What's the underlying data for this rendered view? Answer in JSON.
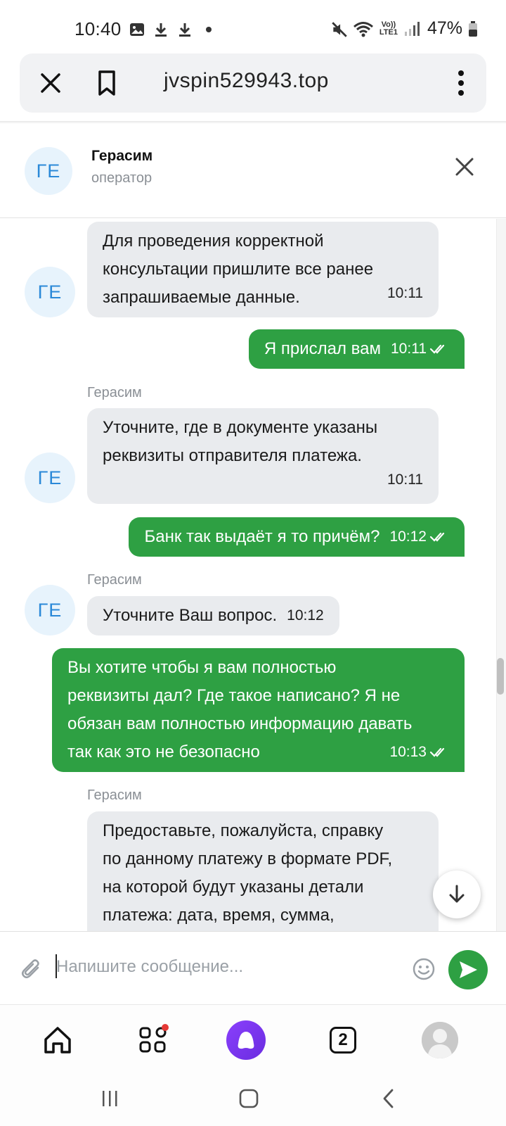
{
  "status_bar": {
    "time": "10:40",
    "battery": "47%",
    "network_label": "LTE1",
    "icons_left": [
      "gallery-icon",
      "download-icon",
      "download-icon",
      "dot-icon"
    ],
    "icons_right": [
      "mute-icon",
      "wifi-icon",
      "volte-icon",
      "signal-icon",
      "battery-icon"
    ]
  },
  "browser": {
    "url": "jvspin529943.top"
  },
  "chat_header": {
    "avatar_initials": "ГЕ",
    "name": "Герасим",
    "role": "оператор"
  },
  "messages": [
    {
      "direction": "in",
      "avatar": "ГЕ",
      "text_lines": [
        "Для проведения корректной",
        "консультации пришлите все ранее",
        "запрашиваемые данные."
      ],
      "time": "10:11"
    },
    {
      "direction": "out",
      "text": "Я прислал вам",
      "time": "10:11",
      "status": "read"
    },
    {
      "direction": "in",
      "sender": "Герасим",
      "avatar": "ГЕ",
      "text_lines": [
        "Уточните, где в документе указаны",
        "реквизиты отправителя платежа."
      ],
      "time": "10:11"
    },
    {
      "direction": "out",
      "text": "Банк так выдаёт я то причём?",
      "time": "10:12",
      "status": "read"
    },
    {
      "direction": "in",
      "sender": "Герасим",
      "avatar": "ГЕ",
      "text": "Уточните Ваш вопрос.",
      "time": "10:12"
    },
    {
      "direction": "out",
      "text_lines": [
        "Вы хотите чтобы я вам полностью",
        "реквизиты дал? Где такое написано? Я не",
        "обязан вам полностью информацию давать",
        "так как это не безопасно"
      ],
      "time": "10:13",
      "status": "read"
    },
    {
      "direction": "in",
      "sender": "Герасим",
      "text_lines": [
        "Предоставьте, пожалуйста, справку",
        "по данному платежу в формате PDF,",
        "на которой будут указаны детали",
        "платежа: дата, время, сумма,"
      ]
    }
  ],
  "input": {
    "placeholder": "Напишите сообщение..."
  },
  "bottom_nav": {
    "tabs_count": "2",
    "items": [
      "home-icon",
      "apps-icon",
      "alice-icon",
      "tabs-icon",
      "profile-icon"
    ]
  },
  "system_nav": [
    "recent-apps-icon",
    "home-button-icon",
    "back-icon"
  ],
  "colors": {
    "outgoing_bubble": "#2ea043",
    "incoming_bubble": "#e9ebee",
    "avatar_bg": "#e7f3fc",
    "avatar_text": "#2b89d8",
    "alice_purple": "#7b35f0",
    "notification_dot": "#e53935"
  }
}
